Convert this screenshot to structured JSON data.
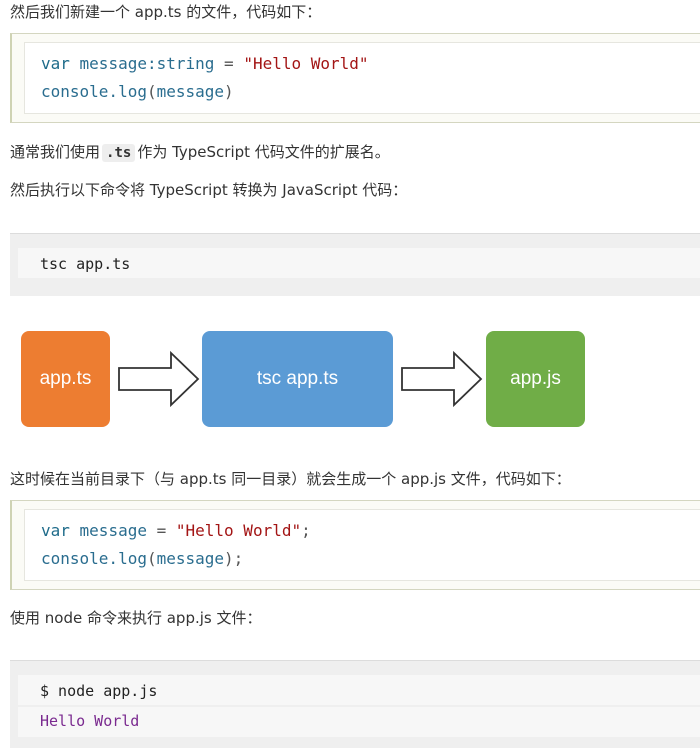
{
  "intro_text": "然后我们新建一个 app.ts 的文件，代码如下：",
  "code_ts": {
    "line1": {
      "kw": "var",
      "name": " message",
      "type": ":string",
      "eq": " = ",
      "str": "\"Hello World\""
    },
    "line2": {
      "obj": "console.log",
      "open": "(",
      "arg": "message",
      "close": ")"
    }
  },
  "ext_text": {
    "before": "通常我们使用",
    "code": ".ts",
    "after": "作为 TypeScript 代码文件的扩展名。"
  },
  "convert_text": "然后执行以下命令将 TypeScript 转换为 JavaScript 代码：",
  "tsc_command": "tsc app.ts",
  "flow": {
    "box1": {
      "label": "app.ts",
      "color": "#ed7d31"
    },
    "box2": {
      "label": "tsc app.ts",
      "color": "#5b9bd5"
    },
    "box3": {
      "label": "app.js",
      "color": "#70ad47"
    }
  },
  "generated_text": "这时候在当前目录下（与 app.ts 同一目录）就会生成一个 app.js 文件，代码如下：",
  "code_js": {
    "line1": {
      "kw": "var",
      "name": " message ",
      "eq": "= ",
      "str": "\"Hello World\"",
      "semi": ";"
    },
    "line2": {
      "obj": "console.log",
      "open": "(",
      "arg": "message",
      "close": ");"
    }
  },
  "node_text": "使用 node 命令来执行 app.js 文件：",
  "node_command": "$ node app.js",
  "node_output": "Hello World",
  "colors": {
    "keyword": "#1e6b8a",
    "string": "#a31515",
    "output": "#7a2a8f"
  }
}
